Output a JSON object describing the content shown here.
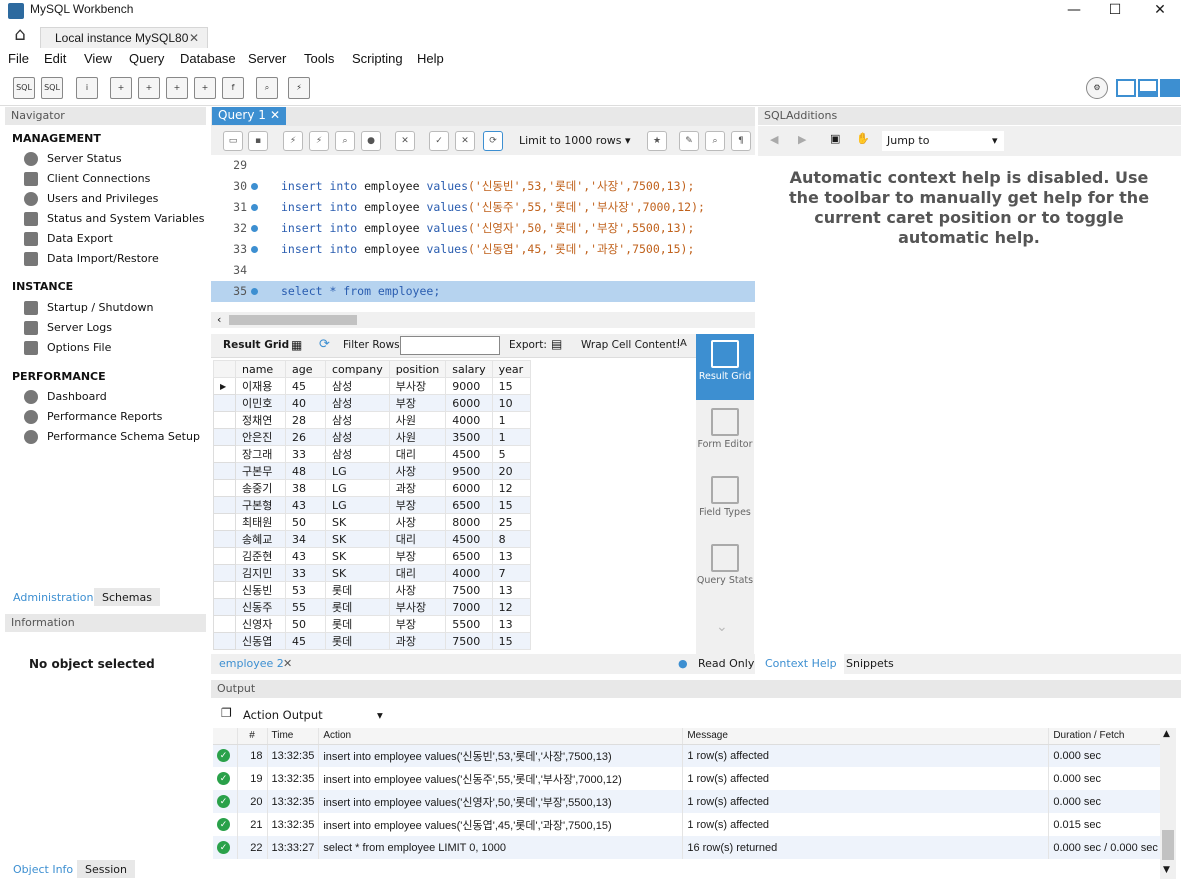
{
  "window": {
    "title": "MySQL Workbench"
  },
  "tabs": {
    "instance": "Local instance MySQL80"
  },
  "menu": [
    "File",
    "Edit",
    "View",
    "Query",
    "Database",
    "Server",
    "Tools",
    "Scripting",
    "Help"
  ],
  "navigator": {
    "title": "Navigator",
    "management": {
      "label": "MANAGEMENT",
      "items": [
        "Server Status",
        "Client Connections",
        "Users and Privileges",
        "Status and System Variables",
        "Data Export",
        "Data Import/Restore"
      ]
    },
    "instance": {
      "label": "INSTANCE",
      "items": [
        "Startup / Shutdown",
        "Server Logs",
        "Options File"
      ]
    },
    "performance": {
      "label": "PERFORMANCE",
      "items": [
        "Dashboard",
        "Performance Reports",
        "Performance Schema Setup"
      ]
    },
    "tab_admin": "Administration",
    "tab_schemas": "Schemas"
  },
  "information": {
    "title": "Information",
    "text": "No object selected",
    "tab_objinfo": "Object Info",
    "tab_session": "Session"
  },
  "editor": {
    "tab": "Query 1",
    "limit": "Limit to 1000 rows",
    "lines": [
      {
        "n": "29",
        "pre": "",
        "kw1": "",
        "mid": "",
        "str": "",
        "post": ""
      },
      {
        "n": "30",
        "kw1": "insert",
        "kw2": "into",
        "tbl": "employee",
        "kw3": "values",
        "args": "('신동빈',53,'롯데','사장',7500,13);"
      },
      {
        "n": "31",
        "kw1": "insert",
        "kw2": "into",
        "tbl": "employee",
        "kw3": "values",
        "args": "('신동주',55,'롯데','부사장',7000,12);"
      },
      {
        "n": "32",
        "kw1": "insert",
        "kw2": "into",
        "tbl": "employee",
        "kw3": "values",
        "args": "('신영자',50,'롯데','부장',5500,13);"
      },
      {
        "n": "33",
        "kw1": "insert",
        "kw2": "into",
        "tbl": "employee",
        "kw3": "values",
        "args": "('신동엽',45,'롯데','과장',7500,15);"
      },
      {
        "n": "34"
      },
      {
        "n": "35",
        "select": "select * from employee;"
      }
    ]
  },
  "grid_toolbar": {
    "result_grid": "Result Grid",
    "filter_rows": "Filter Rows:",
    "export": "Export:",
    "wrap": "Wrap Cell Content:"
  },
  "result": {
    "columns": [
      "name",
      "age",
      "company",
      "position",
      "salary",
      "year"
    ],
    "rows": [
      [
        "이재용",
        "45",
        "삼성",
        "부사장",
        "9000",
        "15"
      ],
      [
        "이민호",
        "40",
        "삼성",
        "부장",
        "6000",
        "10"
      ],
      [
        "정채연",
        "28",
        "삼성",
        "사원",
        "4000",
        "1"
      ],
      [
        "안은진",
        "26",
        "삼성",
        "사원",
        "3500",
        "1"
      ],
      [
        "장그래",
        "33",
        "삼성",
        "대리",
        "4500",
        "5"
      ],
      [
        "구본무",
        "48",
        "LG",
        "사장",
        "9500",
        "20"
      ],
      [
        "송중기",
        "38",
        "LG",
        "과장",
        "6000",
        "12"
      ],
      [
        "구본형",
        "43",
        "LG",
        "부장",
        "6500",
        "15"
      ],
      [
        "최태원",
        "50",
        "SK",
        "사장",
        "8000",
        "25"
      ],
      [
        "송혜교",
        "34",
        "SK",
        "대리",
        "4500",
        "8"
      ],
      [
        "김준현",
        "43",
        "SK",
        "부장",
        "6500",
        "13"
      ],
      [
        "김지민",
        "33",
        "SK",
        "대리",
        "4000",
        "7"
      ],
      [
        "신동빈",
        "53",
        "롯데",
        "사장",
        "7500",
        "13"
      ],
      [
        "신동주",
        "55",
        "롯데",
        "부사장",
        "7000",
        "12"
      ],
      [
        "신영자",
        "50",
        "롯데",
        "부장",
        "5500",
        "13"
      ],
      [
        "신동엽",
        "45",
        "롯데",
        "과장",
        "7500",
        "15"
      ]
    ],
    "footer_tab": "employee 2",
    "read_only": "Read Only"
  },
  "result_side": [
    "Result Grid",
    "Form Editor",
    "Field Types",
    "Query Stats"
  ],
  "sqladditions": {
    "title": "SQLAdditions",
    "jump": "Jump to",
    "help": "Automatic context help is disabled. Use the toolbar to manually get help for the current caret position or to toggle automatic help.",
    "tab_context": "Context Help",
    "tab_snippets": "Snippets"
  },
  "output": {
    "title": "Output",
    "selector": "Action Output",
    "columns": [
      "#",
      "Time",
      "Action",
      "Message",
      "Duration / Fetch"
    ],
    "rows": [
      [
        "18",
        "13:32:35",
        "insert into employee values('신동빈',53,'롯데','사장',7500,13)",
        "1 row(s) affected",
        "0.000 sec"
      ],
      [
        "19",
        "13:32:35",
        "insert into employee values('신동주',55,'롯데','부사장',7000,12)",
        "1 row(s) affected",
        "0.000 sec"
      ],
      [
        "20",
        "13:32:35",
        "insert into employee values('신영자',50,'롯데','부장',5500,13)",
        "1 row(s) affected",
        "0.000 sec"
      ],
      [
        "21",
        "13:32:35",
        "insert into employee values('신동엽',45,'롯데','과장',7500,15)",
        "1 row(s) affected",
        "0.015 sec"
      ],
      [
        "22",
        "13:33:27",
        "select * from employee LIMIT 0, 1000",
        "16 row(s) returned",
        "0.000 sec / 0.000 sec"
      ]
    ]
  },
  "colors": {
    "accent": "#3d8fd1",
    "ok": "#2aa14a",
    "selection": "#b6d3ef"
  }
}
